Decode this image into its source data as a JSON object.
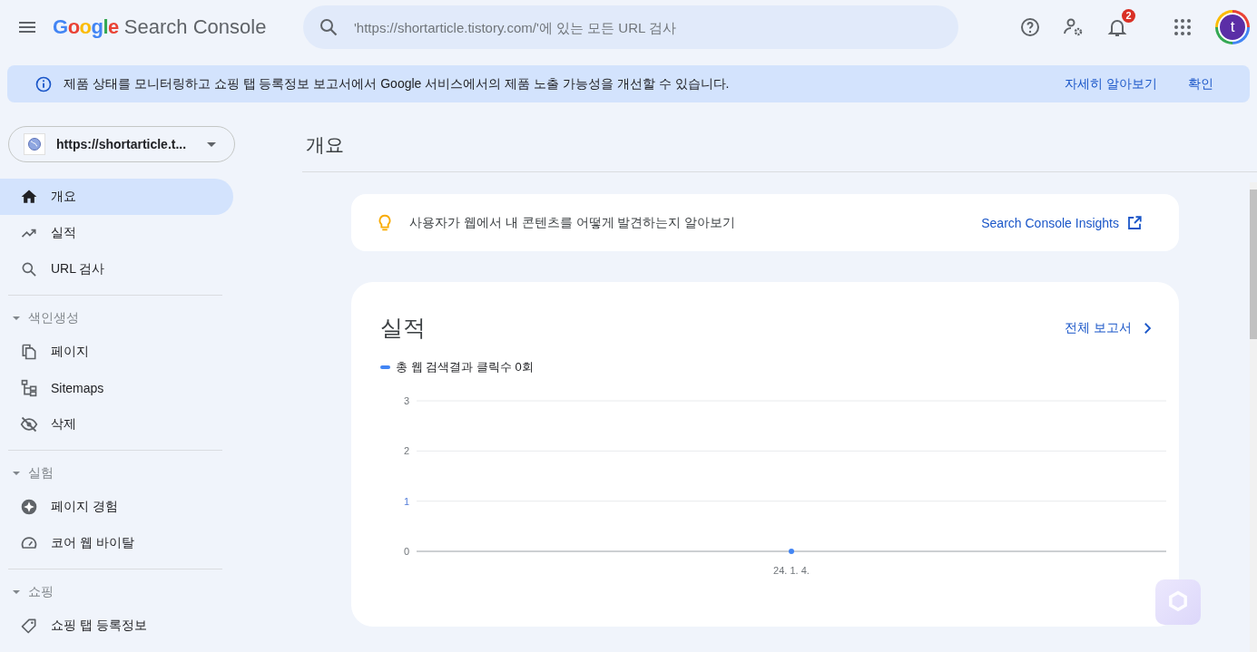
{
  "header": {
    "brand": "Google",
    "product": "Search Console",
    "search": {
      "placeholder": "'https://shortarticle.tistory.com/'에 있는 모든 URL 검사"
    },
    "notification_count": "2",
    "avatar_letter": "t"
  },
  "banner": {
    "message": "제품 상태를 모니터링하고 쇼핑 탭 등록정보 보고서에서 Google 서비스에서의 제품 노출 가능성을 개선할 수 있습니다.",
    "learn_more": "자세히 알아보기",
    "dismiss": "확인"
  },
  "sidebar": {
    "property": "https://shortarticle.t...",
    "sections": [
      {
        "items": [
          {
            "label": "개요",
            "selected": true
          },
          {
            "label": "실적",
            "selected": false
          },
          {
            "label": "URL 검사",
            "selected": false
          }
        ]
      },
      {
        "title": "색인생성",
        "expanded": true,
        "items": [
          {
            "label": "페이지",
            "selected": false
          },
          {
            "label": "Sitemaps",
            "selected": false
          },
          {
            "label": "삭제",
            "selected": false
          }
        ]
      },
      {
        "title": "실험",
        "expanded": true,
        "items": [
          {
            "label": "페이지 경험",
            "selected": false
          },
          {
            "label": "코어 웹 바이탈",
            "selected": false
          }
        ]
      },
      {
        "title": "쇼핑",
        "expanded": true,
        "items": [
          {
            "label": "쇼핑 탭 등록정보",
            "selected": false
          }
        ]
      }
    ]
  },
  "page_title": "개요",
  "insight_card": {
    "text": "사용자가 웹에서 내 콘텐츠를 어떻게 발견하는지 알아보기",
    "link": "Search Console Insights"
  },
  "performance_card": {
    "title": "실적",
    "full_report": "전체 보고서",
    "chart_data": {
      "type": "line",
      "x": [
        "24. 1. 4."
      ],
      "series": [
        {
          "name": "총 웹 검색결과 클릭수 0회",
          "color": "#4285f4",
          "marker": true,
          "values": [
            0
          ]
        }
      ],
      "ylim": [
        0,
        3
      ],
      "yticks": [
        0,
        1,
        2,
        3
      ]
    }
  }
}
